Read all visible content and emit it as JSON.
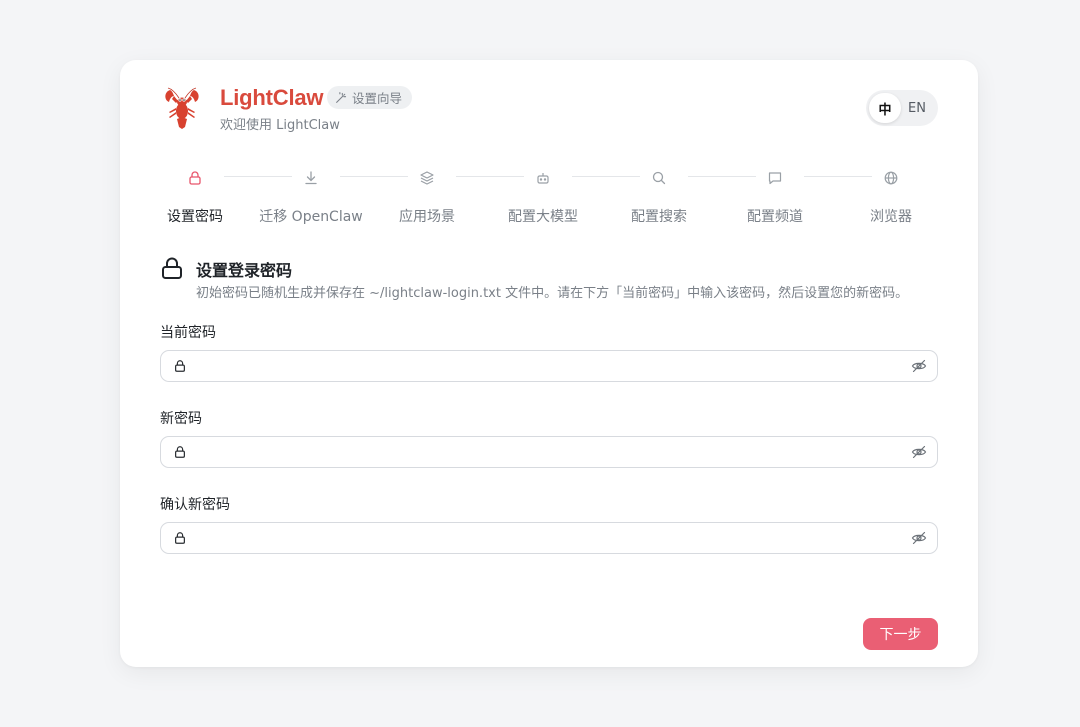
{
  "header": {
    "brand_name": "LightClaw",
    "badge_label": "设置向导",
    "subtitle": "欢迎使用 LightClaw",
    "lang_options": [
      "中",
      "EN"
    ],
    "lang_selected": "中"
  },
  "steps": [
    {
      "label": "设置密码",
      "icon": "lock-icon",
      "active": true
    },
    {
      "label": "迁移 OpenClaw",
      "icon": "download-icon",
      "active": false
    },
    {
      "label": "应用场景",
      "icon": "layers-icon",
      "active": false
    },
    {
      "label": "配置大模型",
      "icon": "bot-icon",
      "active": false
    },
    {
      "label": "配置搜索",
      "icon": "search-icon",
      "active": false
    },
    {
      "label": "配置频道",
      "icon": "message-icon",
      "active": false
    },
    {
      "label": "浏览器",
      "icon": "globe-icon",
      "active": false
    }
  ],
  "section": {
    "title": "设置登录密码",
    "description": "初始密码已随机生成并保存在 ~/lightclaw-login.txt 文件中。请在下方「当前密码」中输入该密码，然后设置您的新密码。"
  },
  "fields": [
    {
      "label": "当前密码",
      "value": "",
      "placeholder": ""
    },
    {
      "label": "新密码",
      "value": "",
      "placeholder": ""
    },
    {
      "label": "确认新密码",
      "value": "",
      "placeholder": ""
    }
  ],
  "actions": {
    "next_label": "下一步"
  },
  "colors": {
    "accent": "#ea5f74",
    "brand": "#d94a3d",
    "active_icon": "#e8556b"
  }
}
